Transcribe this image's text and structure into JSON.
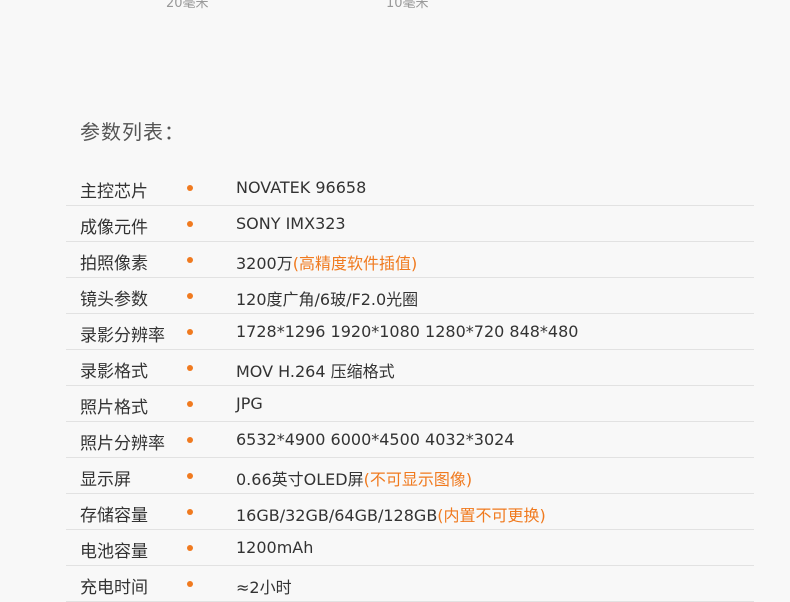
{
  "top_partial": [
    "20毫米",
    "10毫米"
  ],
  "heading": "参数列表：",
  "accent_color": "#f07a1f",
  "specs": [
    {
      "label": "主控芯片",
      "value": "NOVATEK  96658",
      "note": ""
    },
    {
      "label": "成像元件",
      "value": "SONY  IMX323",
      "note": ""
    },
    {
      "label": "拍照像素",
      "value": "3200万",
      "note": "(高精度软件插值)"
    },
    {
      "label": "镜头参数",
      "value": "120度广角/6玻/F2.0光圈",
      "note": ""
    },
    {
      "label": "录影分辨率",
      "value": "1728*1296 1920*1080 1280*720  848*480",
      "note": ""
    },
    {
      "label": "录影格式",
      "value": "MOV H.264 压缩格式",
      "note": ""
    },
    {
      "label": "照片格式",
      "value": "JPG",
      "note": ""
    },
    {
      "label": "照片分辨率",
      "value": "6532*4900 6000*4500 4032*3024",
      "note": ""
    },
    {
      "label": "显示屏",
      "value": "0.66英寸OLED屏",
      "note": "(不可显示图像)"
    },
    {
      "label": "存储容量",
      "value": "16GB/32GB/64GB/128GB",
      "note": "(内置不可更换)"
    },
    {
      "label": "电池容量",
      "value": "1200mAh",
      "note": ""
    },
    {
      "label": "充电时间",
      "value": "≈2小时",
      "note": ""
    }
  ]
}
